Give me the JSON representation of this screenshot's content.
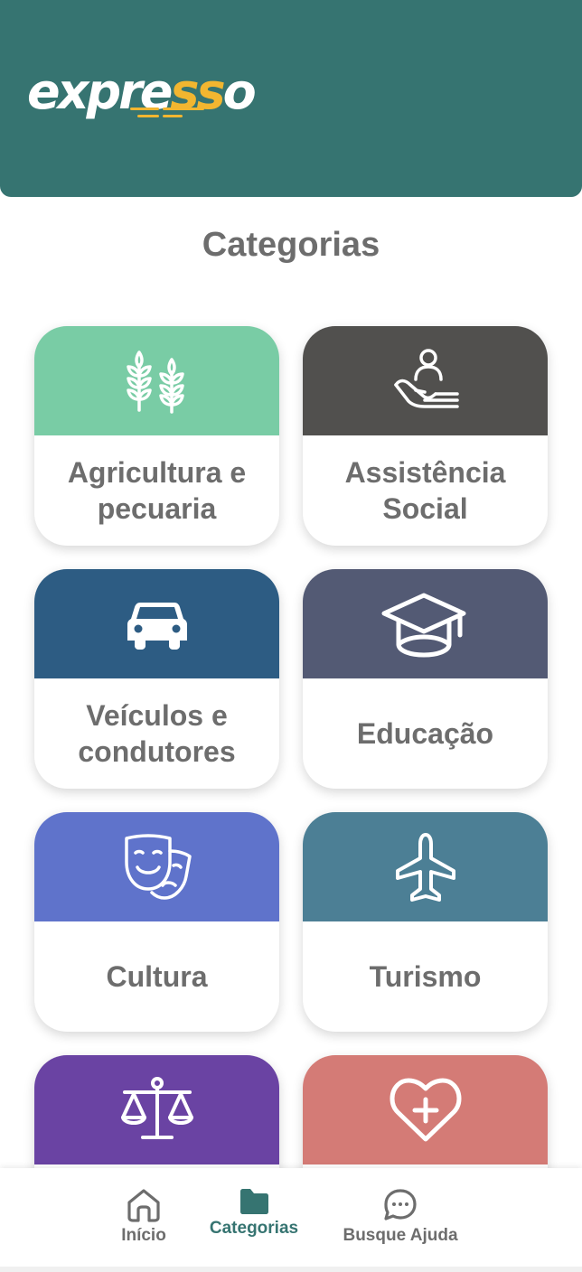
{
  "app": {
    "logo_prefix": "expre",
    "logo_highlight": "ss",
    "logo_suffix": "o"
  },
  "page": {
    "title": "Categorias"
  },
  "colors": {
    "header": "#367471",
    "logo_accent": "#f2b630",
    "text_gray": "#6d6d6d"
  },
  "categories": [
    {
      "label": "Agricultura e pecuaria",
      "icon": "wheat-icon",
      "color": "#79cca5"
    },
    {
      "label": "Assistência Social",
      "icon": "hand-person-icon",
      "color": "#51504e"
    },
    {
      "label": "Veículos e condutores",
      "icon": "car-icon",
      "color": "#2d5c83"
    },
    {
      "label": "Educação",
      "icon": "graduation-cap-icon",
      "color": "#535a74"
    },
    {
      "label": "Cultura",
      "icon": "theater-masks-icon",
      "color": "#5f73cb"
    },
    {
      "label": "Turismo",
      "icon": "airplane-icon",
      "color": "#4c7f95"
    },
    {
      "label": "",
      "icon": "scales-icon",
      "color": "#6a43a3"
    },
    {
      "label": "",
      "icon": "heart-plus-icon",
      "color": "#d47b76"
    }
  ],
  "nav": {
    "items": [
      {
        "label": "Início",
        "icon": "home-icon",
        "active": false
      },
      {
        "label": "Categorias",
        "icon": "folder-icon",
        "active": true
      },
      {
        "label": "Busque Ajuda",
        "icon": "chat-bubble-icon",
        "active": false
      }
    ]
  }
}
